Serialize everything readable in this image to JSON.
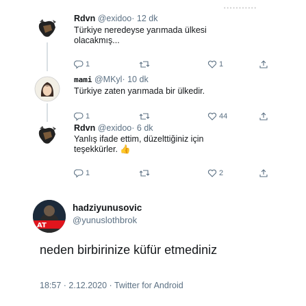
{
  "replies": [
    {
      "name": "Rdvn",
      "handle": "@exidoo",
      "time": "12 dk",
      "lines": [
        "Türkiye neredeyse yarımada ülkesi",
        "olacakmış..."
      ],
      "reply_count": "1",
      "retweet_count": "",
      "like_count": "1"
    },
    {
      "name": "mami",
      "handle": "@MKyl",
      "time": "10 dk",
      "lines": [
        "Türkiye zaten yarımada bir ülkedir."
      ],
      "reply_count": "1",
      "retweet_count": "",
      "like_count": "44"
    },
    {
      "name": "Rdvn",
      "handle": "@exidoo",
      "time": "6 dk",
      "lines": [
        "Yanlış ifade ettim, düzelttiğiniz için",
        "teşekkürler. 👍"
      ],
      "reply_count": "1",
      "retweet_count": "",
      "like_count": "2"
    }
  ],
  "main_tweet": {
    "name": "hadziyunusovic",
    "handle": "@yunuslothbrok",
    "text": "neden birbirinize küfür etmediniz",
    "time": "18:57",
    "date": "2.12.2020",
    "source": "Twitter for Android",
    "avatar_badge": "AT"
  }
}
